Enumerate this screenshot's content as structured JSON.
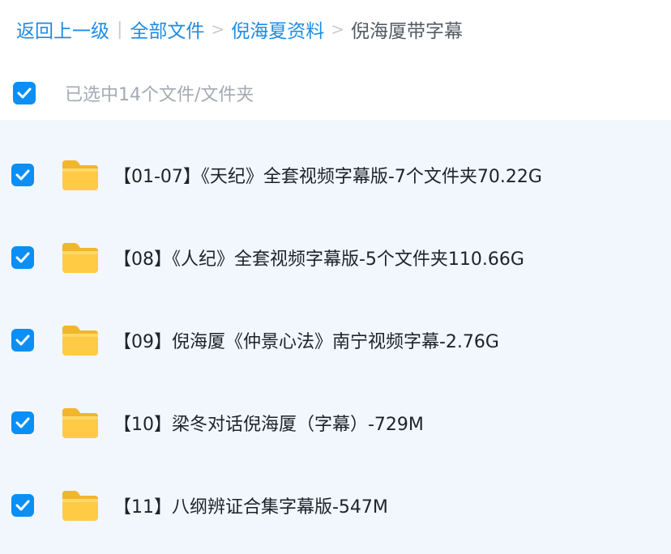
{
  "breadcrumb": {
    "back": "返回上一级",
    "bar": "|",
    "all_files": "全部文件",
    "sep1": ">",
    "parent": "倪海夏资料",
    "sep2": ">",
    "current": "倪海厦带字幕"
  },
  "selection": {
    "text": "已选中14个文件/文件夹"
  },
  "files": [
    {
      "name": "【01-07】《天纪》全套视频字幕版-7个文件夹70.22G"
    },
    {
      "name": "【08】《人纪》全套视频字幕版-5个文件夹110.66G"
    },
    {
      "name": "【09】倪海厦《仲景心法》南宁视频字幕-2.76G"
    },
    {
      "name": "【10】梁冬对话倪海厦（字幕）-729M"
    },
    {
      "name": "【11】八纲辨证合集字幕版-547M"
    }
  ],
  "colors": {
    "accent": "#0b8ff5",
    "link": "#1c8ce6",
    "list_background": "#f1f7fd",
    "folder": "#ffc83d"
  },
  "icons": {
    "checkbox": "checkbox-checked-icon",
    "folder": "folder-icon"
  }
}
